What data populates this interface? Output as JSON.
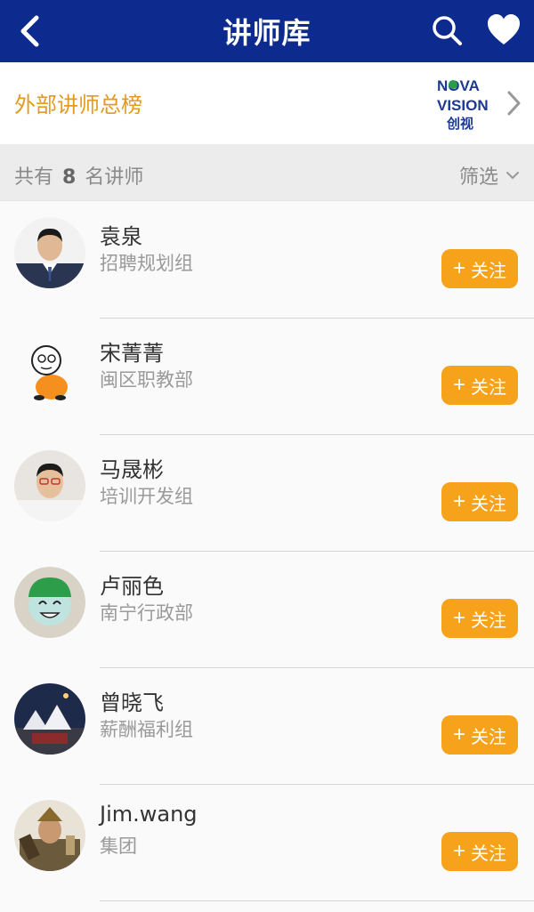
{
  "header": {
    "title": "讲师库"
  },
  "banner": {
    "label": "外部讲师总榜",
    "logo_text_top": "NOVA",
    "logo_text_mid": "VISION",
    "logo_text_bottom": "创视"
  },
  "countbar": {
    "prefix": "共有",
    "count": "8",
    "suffix": "名讲师",
    "filter_label": "筛选"
  },
  "colors": {
    "header_bg": "#0d2b8f",
    "accent": "#f6a21b",
    "banner_label": "#e39a1e"
  },
  "follow_label": "关注",
  "lecturers": [
    {
      "name": "袁泉",
      "dept": "招聘规划组",
      "follow": "关注"
    },
    {
      "name": "宋菁菁",
      "dept": "闽区职教部",
      "follow": "关注"
    },
    {
      "name": "马晟彬",
      "dept": "培训开发组",
      "follow": "关注"
    },
    {
      "name": "卢丽色",
      "dept": "南宁行政部",
      "follow": "关注"
    },
    {
      "name": "曾晓飞",
      "dept": "薪酬福利组",
      "follow": "关注"
    },
    {
      "name": "Jim.wang",
      "dept": "集团",
      "follow": "关注"
    }
  ]
}
